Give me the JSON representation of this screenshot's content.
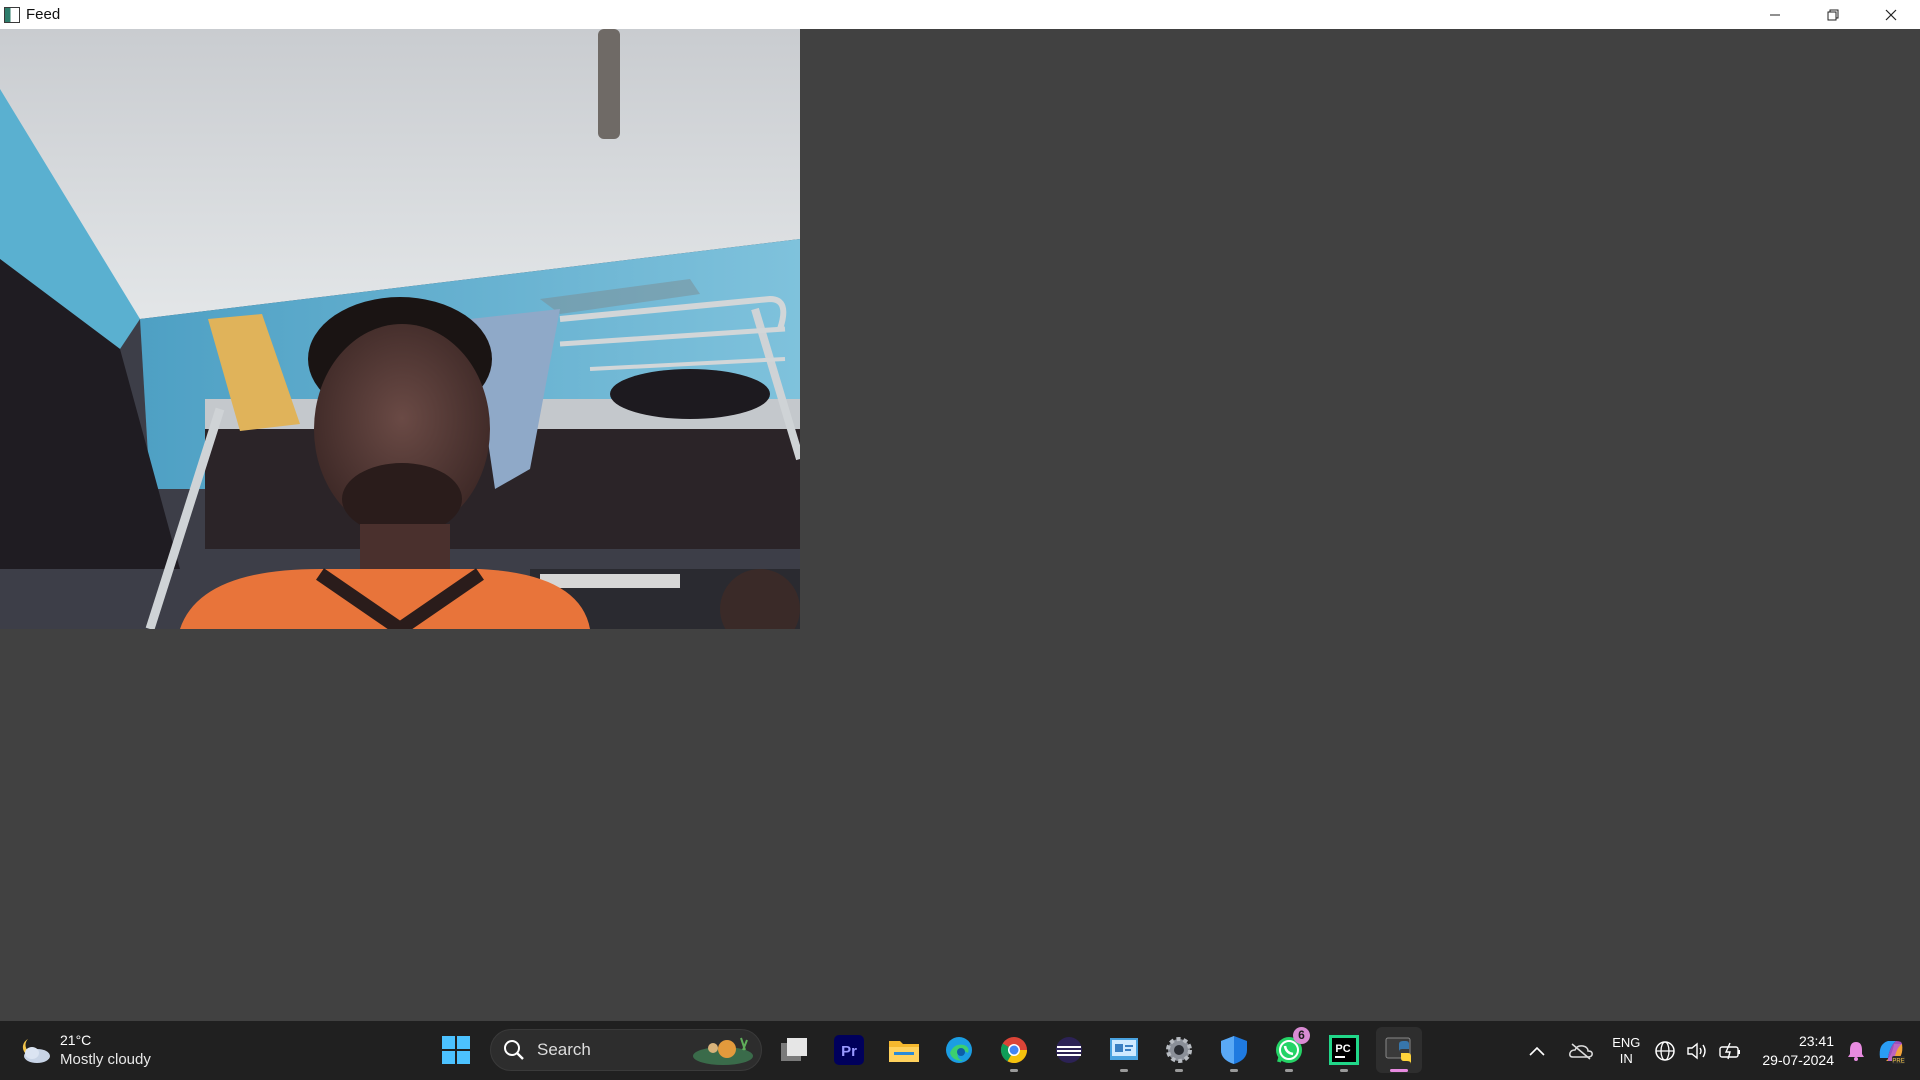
{
  "window": {
    "title": "Feed",
    "controls": [
      "minimize-icon",
      "restore-icon",
      "close-icon"
    ]
  },
  "taskbar": {
    "weather": {
      "temperature": "21°C",
      "condition": "Mostly cloudy",
      "icon": "partly-cloudy-night-icon"
    },
    "search": {
      "label": "Search"
    },
    "apps": [
      {
        "name": "start-button",
        "icon": "windows-logo-icon"
      },
      {
        "name": "task-view",
        "icon": "task-view-icon"
      },
      {
        "name": "premiere-pro",
        "icon": "premiere-pro-icon",
        "label": "Pr"
      },
      {
        "name": "file-explorer",
        "icon": "folder-icon"
      },
      {
        "name": "edge",
        "icon": "edge-icon"
      },
      {
        "name": "chrome",
        "icon": "chrome-icon",
        "running": true
      },
      {
        "name": "eclipse",
        "icon": "eclipse-icon"
      },
      {
        "name": "control-panel",
        "icon": "control-panel-icon",
        "running": true
      },
      {
        "name": "settings",
        "icon": "gear-icon",
        "running": true
      },
      {
        "name": "defender",
        "icon": "shield-icon",
        "running": true
      },
      {
        "name": "whatsapp",
        "icon": "whatsapp-icon",
        "running": true,
        "badge": "6"
      },
      {
        "name": "pycharm",
        "icon": "pycharm-icon",
        "label": "PC",
        "running": true
      },
      {
        "name": "python",
        "icon": "python-icon",
        "running": true,
        "active": true
      }
    ],
    "tray": {
      "language_line1": "ENG",
      "language_line2": "IN",
      "time": "23:41",
      "date": "29-07-2024"
    }
  },
  "colors": {
    "window_bg": "#414141",
    "taskbar_bg": "#202020",
    "active_indicator": "#e88be0"
  }
}
